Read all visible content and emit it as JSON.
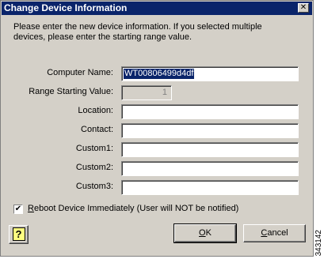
{
  "window": {
    "title": "Change Device Information",
    "close_glyph": "✕"
  },
  "intro": "Please enter the new device information.  If you selected multiple\ndevices, please enter the starting range value.",
  "fields": {
    "computer_name": {
      "label": "Computer Name:",
      "value": "WT00806499d4df"
    },
    "range_start": {
      "label": "Range Starting Value:",
      "value": "1"
    },
    "location": {
      "label": "Location:",
      "value": ""
    },
    "contact": {
      "label": "Contact:",
      "value": ""
    },
    "custom1": {
      "label": "Custom1:",
      "value": ""
    },
    "custom2": {
      "label": "Custom2:",
      "value": ""
    },
    "custom3": {
      "label": "Custom3:",
      "value": ""
    }
  },
  "reboot": {
    "checked": true,
    "check_glyph": "✔",
    "label_accel": "R",
    "label_rest": "eboot Device Immediately (User will NOT be notified)"
  },
  "buttons": {
    "help_glyph": "?",
    "ok_accel": "O",
    "ok_rest": "K",
    "cancel_accel": "C",
    "cancel_rest": "ancel"
  },
  "figure_id": "343142",
  "colors": {
    "titlebar": "#0a246a",
    "face": "#d4d0c8",
    "selection": "#0a246a"
  }
}
